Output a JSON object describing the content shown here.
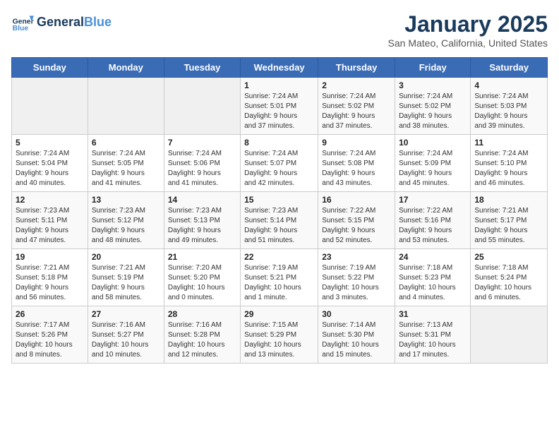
{
  "header": {
    "logo_line1": "General",
    "logo_line2": "Blue",
    "title": "January 2025",
    "subtitle": "San Mateo, California, United States"
  },
  "days_of_week": [
    "Sunday",
    "Monday",
    "Tuesday",
    "Wednesday",
    "Thursday",
    "Friday",
    "Saturday"
  ],
  "weeks": [
    [
      {
        "day": "",
        "info": ""
      },
      {
        "day": "",
        "info": ""
      },
      {
        "day": "",
        "info": ""
      },
      {
        "day": "1",
        "info": "Sunrise: 7:24 AM\nSunset: 5:01 PM\nDaylight: 9 hours\nand 37 minutes."
      },
      {
        "day": "2",
        "info": "Sunrise: 7:24 AM\nSunset: 5:02 PM\nDaylight: 9 hours\nand 37 minutes."
      },
      {
        "day": "3",
        "info": "Sunrise: 7:24 AM\nSunset: 5:02 PM\nDaylight: 9 hours\nand 38 minutes."
      },
      {
        "day": "4",
        "info": "Sunrise: 7:24 AM\nSunset: 5:03 PM\nDaylight: 9 hours\nand 39 minutes."
      }
    ],
    [
      {
        "day": "5",
        "info": "Sunrise: 7:24 AM\nSunset: 5:04 PM\nDaylight: 9 hours\nand 40 minutes."
      },
      {
        "day": "6",
        "info": "Sunrise: 7:24 AM\nSunset: 5:05 PM\nDaylight: 9 hours\nand 41 minutes."
      },
      {
        "day": "7",
        "info": "Sunrise: 7:24 AM\nSunset: 5:06 PM\nDaylight: 9 hours\nand 41 minutes."
      },
      {
        "day": "8",
        "info": "Sunrise: 7:24 AM\nSunset: 5:07 PM\nDaylight: 9 hours\nand 42 minutes."
      },
      {
        "day": "9",
        "info": "Sunrise: 7:24 AM\nSunset: 5:08 PM\nDaylight: 9 hours\nand 43 minutes."
      },
      {
        "day": "10",
        "info": "Sunrise: 7:24 AM\nSunset: 5:09 PM\nDaylight: 9 hours\nand 45 minutes."
      },
      {
        "day": "11",
        "info": "Sunrise: 7:24 AM\nSunset: 5:10 PM\nDaylight: 9 hours\nand 46 minutes."
      }
    ],
    [
      {
        "day": "12",
        "info": "Sunrise: 7:23 AM\nSunset: 5:11 PM\nDaylight: 9 hours\nand 47 minutes."
      },
      {
        "day": "13",
        "info": "Sunrise: 7:23 AM\nSunset: 5:12 PM\nDaylight: 9 hours\nand 48 minutes."
      },
      {
        "day": "14",
        "info": "Sunrise: 7:23 AM\nSunset: 5:13 PM\nDaylight: 9 hours\nand 49 minutes."
      },
      {
        "day": "15",
        "info": "Sunrise: 7:23 AM\nSunset: 5:14 PM\nDaylight: 9 hours\nand 51 minutes."
      },
      {
        "day": "16",
        "info": "Sunrise: 7:22 AM\nSunset: 5:15 PM\nDaylight: 9 hours\nand 52 minutes."
      },
      {
        "day": "17",
        "info": "Sunrise: 7:22 AM\nSunset: 5:16 PM\nDaylight: 9 hours\nand 53 minutes."
      },
      {
        "day": "18",
        "info": "Sunrise: 7:21 AM\nSunset: 5:17 PM\nDaylight: 9 hours\nand 55 minutes."
      }
    ],
    [
      {
        "day": "19",
        "info": "Sunrise: 7:21 AM\nSunset: 5:18 PM\nDaylight: 9 hours\nand 56 minutes."
      },
      {
        "day": "20",
        "info": "Sunrise: 7:21 AM\nSunset: 5:19 PM\nDaylight: 9 hours\nand 58 minutes."
      },
      {
        "day": "21",
        "info": "Sunrise: 7:20 AM\nSunset: 5:20 PM\nDaylight: 10 hours\nand 0 minutes."
      },
      {
        "day": "22",
        "info": "Sunrise: 7:19 AM\nSunset: 5:21 PM\nDaylight: 10 hours\nand 1 minute."
      },
      {
        "day": "23",
        "info": "Sunrise: 7:19 AM\nSunset: 5:22 PM\nDaylight: 10 hours\nand 3 minutes."
      },
      {
        "day": "24",
        "info": "Sunrise: 7:18 AM\nSunset: 5:23 PM\nDaylight: 10 hours\nand 4 minutes."
      },
      {
        "day": "25",
        "info": "Sunrise: 7:18 AM\nSunset: 5:24 PM\nDaylight: 10 hours\nand 6 minutes."
      }
    ],
    [
      {
        "day": "26",
        "info": "Sunrise: 7:17 AM\nSunset: 5:26 PM\nDaylight: 10 hours\nand 8 minutes."
      },
      {
        "day": "27",
        "info": "Sunrise: 7:16 AM\nSunset: 5:27 PM\nDaylight: 10 hours\nand 10 minutes."
      },
      {
        "day": "28",
        "info": "Sunrise: 7:16 AM\nSunset: 5:28 PM\nDaylight: 10 hours\nand 12 minutes."
      },
      {
        "day": "29",
        "info": "Sunrise: 7:15 AM\nSunset: 5:29 PM\nDaylight: 10 hours\nand 13 minutes."
      },
      {
        "day": "30",
        "info": "Sunrise: 7:14 AM\nSunset: 5:30 PM\nDaylight: 10 hours\nand 15 minutes."
      },
      {
        "day": "31",
        "info": "Sunrise: 7:13 AM\nSunset: 5:31 PM\nDaylight: 10 hours\nand 17 minutes."
      },
      {
        "day": "",
        "info": ""
      }
    ]
  ]
}
